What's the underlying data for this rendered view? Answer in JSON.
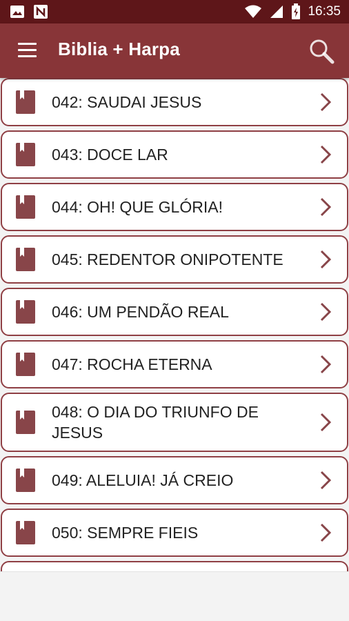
{
  "status_bar": {
    "time": "16:35",
    "icons": [
      "image-icon",
      "nfc-icon",
      "wifi-icon",
      "signal-icon",
      "battery-icon"
    ]
  },
  "app_bar": {
    "title": "Biblia + Harpa",
    "menu_icon": "menu-icon",
    "search_icon": "search-icon"
  },
  "colors": {
    "status_bar": "#5e1619",
    "app_bar": "#883538",
    "accent": "#8f3f44",
    "book_icon": "#884549"
  },
  "hymns": [
    {
      "label": "042: SAUDAI JESUS"
    },
    {
      "label": "043: DOCE LAR"
    },
    {
      "label": "044: OH! QUE GLÓRIA!"
    },
    {
      "label": "045: REDENTOR ONIPOTENTE"
    },
    {
      "label": "046: UM PENDÃO REAL"
    },
    {
      "label": "047: ROCHA ETERNA"
    },
    {
      "label": "048: O DIA DO TRIUNFO DE JESUS"
    },
    {
      "label": "049: ALELUIA! JÁ CREIO"
    },
    {
      "label": "050: SEMPRE FIEIS"
    },
    {
      "label": ""
    }
  ]
}
